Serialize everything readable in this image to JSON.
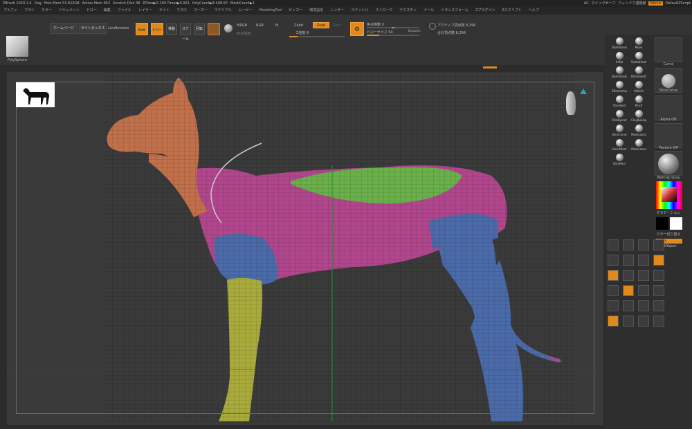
{
  "titlebar": {
    "items": [
      "ZBrush 2020.1.4",
      "Dog",
      "Free Mem 53.823GB",
      "Active Mem 952",
      "Scratch Disk 48",
      "RTime▶0.199 Timer▶0.001",
      "PolyCount▶8.408 KP",
      "MeshCount▶1"
    ],
    "right": [
      "AC",
      "クイックセーブ",
      "ウィンドウ透明度",
      "Menus",
      "DefaultZScript"
    ]
  },
  "menubar": [
    "アルファ",
    "ブラシ",
    "カラー",
    "ドキュメント",
    "ドロー",
    "編集",
    "ファイル",
    "レイヤー",
    "ライト",
    "マクロ",
    "マーカー",
    "マテリアル",
    "ムービー",
    "ModelingTool",
    "ピッカー",
    "環境設定",
    "レンダー",
    "ステンシル",
    "ストローク",
    "テクスチャ",
    "ツール",
    "トランスフォーム",
    "Zプラグイン",
    "Zスクリプト",
    "ヘルプ"
  ],
  "shelf": {
    "home": "ホームページ",
    "lightbox": "ライトボックス",
    "liveboolean": "LiveBoolean",
    "edit": "Edit",
    "draw": "ドロー",
    "move": "移動",
    "scale": "スケール",
    "rotate": "回転",
    "mrgb": "MRGB",
    "rgb": "RGB",
    "m": "M",
    "rgb_intensity": "RGB強度",
    "zadd": "Zadd",
    "zsub": "Zsub",
    "zcut": "Zcut",
    "z_intensity": "Z強度 8",
    "focal": "焦点移動 0",
    "draw_size": "ドローサイズ 64",
    "dynamic": "Dynamic",
    "active_points": "アクティブ頂点数 8,296",
    "total_points": "合計頂点数 8,296",
    "tool_name": "PolySphere"
  },
  "brushes": [
    "DamStandard",
    "Move",
    "Inflat",
    "SnakeHook",
    "DamStandard",
    "BGrSmooth",
    "ZRemesherGuide",
    "hPolish",
    "Standard",
    "Pinch",
    "TrimDynamic",
    "ClayBuildup",
    "SliceCurve",
    "MaskLasso",
    "SelectRect",
    "MaskLasso",
    "SliceRect"
  ],
  "right_slots": {
    "curve": "Curve",
    "slice_curve": "SliceCurve",
    "alpha_off": "Alpha Off",
    "texture_off": "Texture Off",
    "material": "MatCap Gray",
    "gradient": "グラデーション",
    "switch_color": "カラー切り替え",
    "fill_object": "FillObject",
    "fill_badge": "入れ替え"
  },
  "colors": {
    "accent": "#e08a1e",
    "head": "#c0704a",
    "body": "#b0468c",
    "back": "#6ab04a",
    "chest": "#4a6aa8",
    "leg": "#a8aa3c"
  }
}
